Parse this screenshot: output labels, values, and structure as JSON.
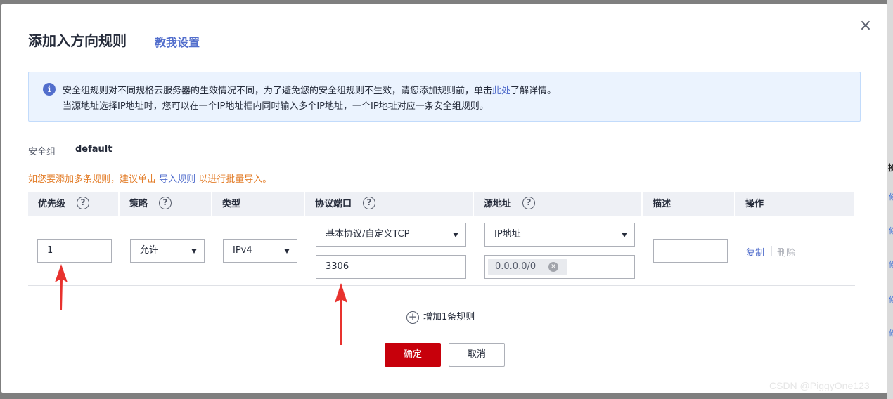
{
  "dialog": {
    "title": "添加入方向规则",
    "teach_link": "教我设置",
    "close_icon": "×"
  },
  "notice": {
    "icon": "i",
    "line1_before": "安全组规则对不同规格云服务器的生效情况不同，为了避免您的安全组规则不生效，请您添加规则前，单击",
    "line1_link": "此处",
    "line1_after": "了解详情。",
    "line2": "当源地址选择IP地址时，您可以在一个IP地址框内同时输入多个IP地址，一个IP地址对应一条安全组规则。"
  },
  "security_group": {
    "label": "安全组",
    "value": "default"
  },
  "hint": {
    "before": "如您要添加多条规则，建议单击 ",
    "link": "导入规则",
    "after": " 以进行批量导入。"
  },
  "table": {
    "headers": {
      "priority": "优先级",
      "policy": "策略",
      "type": "类型",
      "protocol_port": "协议端口",
      "source": "源地址",
      "description": "描述",
      "operation": "操作"
    },
    "help_icon": "?",
    "row": {
      "priority": "1",
      "policy": "允许",
      "type": "IPv4",
      "protocol": "基本协议/自定义TCP",
      "port": "3306",
      "source_type": "IP地址",
      "source_ip": "0.0.0.0/0",
      "description": "",
      "copy": "复制",
      "delete": "删除"
    }
  },
  "add_rule": {
    "icon": "+",
    "label": "增加1条规则"
  },
  "buttons": {
    "ok": "确定",
    "cancel": "取消"
  },
  "watermark": "CSDN @PiggyOne123",
  "colors": {
    "primary": "#c7000b",
    "link": "#526ecc",
    "warning": "#e37d29",
    "annotation_arrow": "#e8322e"
  }
}
